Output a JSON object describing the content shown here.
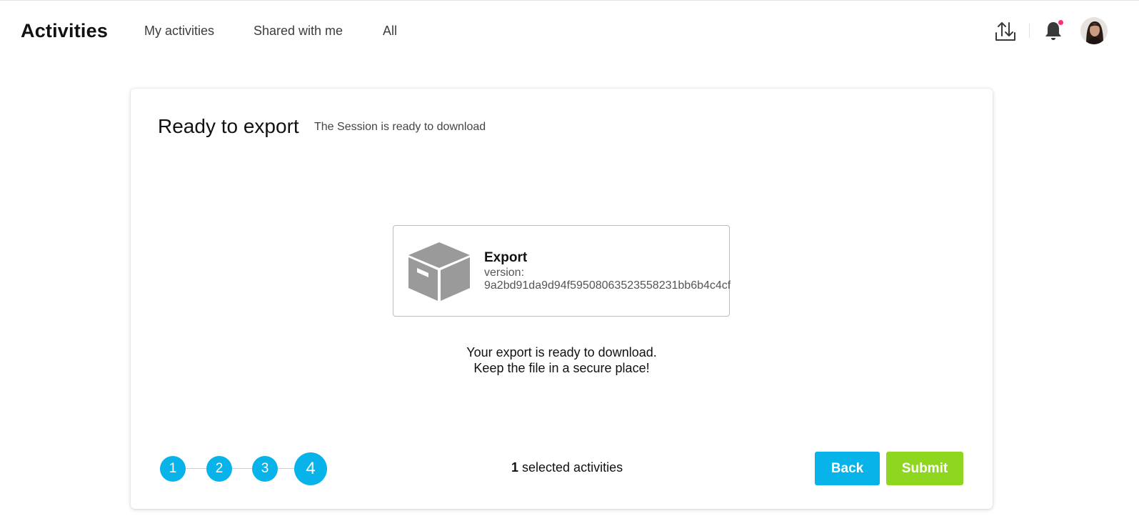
{
  "header": {
    "title": "Activities",
    "nav": {
      "my_activities": "My activities",
      "shared_with_me": "Shared with me",
      "all": "All"
    },
    "icons": [
      "upload-icon",
      "bell-icon",
      "avatar"
    ],
    "notification_dot_color": "#ff2d7a"
  },
  "card": {
    "title": "Ready to export",
    "subtitle": "The Session is ready to download",
    "export": {
      "name": "Export",
      "version_label": "version:",
      "version_value": "9a2bd91da9d94f59508063523558231bb6b4c4cf",
      "icon": "box-icon"
    },
    "message_line1": "Your export is ready to download.",
    "message_line2": "Keep the file in a secure place!",
    "steps": [
      "1",
      "2",
      "3",
      "4"
    ],
    "current_step": "4",
    "selected_count": "1",
    "selected_label": " selected activities",
    "back_label": "Back",
    "submit_label": "Submit"
  },
  "colors": {
    "accent_blue": "#08b3ea",
    "submit_green": "#8fd620"
  }
}
